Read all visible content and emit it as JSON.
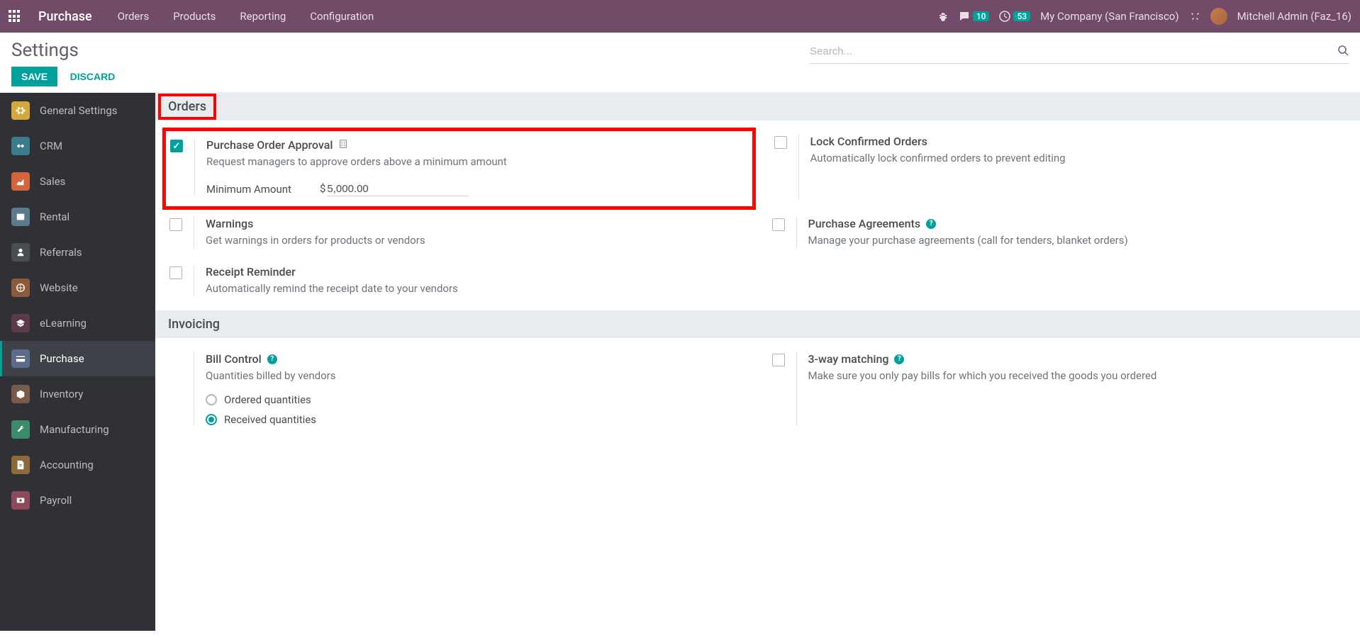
{
  "navbar": {
    "app_title": "Purchase",
    "menus": [
      "Orders",
      "Products",
      "Reporting",
      "Configuration"
    ],
    "messages_count": "10",
    "activities_count": "53",
    "company": "My Company (San Francisco)",
    "user": "Mitchell Admin (Faz_16)"
  },
  "control": {
    "title": "Settings",
    "save": "SAVE",
    "discard": "DISCARD",
    "search_placeholder": "Search..."
  },
  "sidebar": {
    "items": [
      {
        "label": "General Settings"
      },
      {
        "label": "CRM"
      },
      {
        "label": "Sales"
      },
      {
        "label": "Rental"
      },
      {
        "label": "Referrals"
      },
      {
        "label": "Website"
      },
      {
        "label": "eLearning"
      },
      {
        "label": "Purchase"
      },
      {
        "label": "Inventory"
      },
      {
        "label": "Manufacturing"
      },
      {
        "label": "Accounting"
      },
      {
        "label": "Payroll"
      }
    ],
    "active_index": 7
  },
  "sections": {
    "orders": {
      "heading": "Orders",
      "po_approval": {
        "title": "Purchase Order Approval",
        "desc": "Request managers to approve orders above a minimum amount",
        "min_label": "Minimum Amount",
        "currency": "$",
        "min_value": "5,000.00",
        "checked": true
      },
      "lock_confirmed": {
        "title": "Lock Confirmed Orders",
        "desc": "Automatically lock confirmed orders to prevent editing",
        "checked": false
      },
      "warnings": {
        "title": "Warnings",
        "desc": "Get warnings in orders for products or vendors",
        "checked": false
      },
      "purchase_agreements": {
        "title": "Purchase Agreements",
        "desc": "Manage your purchase agreements (call for tenders, blanket orders)",
        "checked": false
      },
      "receipt_reminder": {
        "title": "Receipt Reminder",
        "desc": "Automatically remind the receipt date to your vendors",
        "checked": false
      }
    },
    "invoicing": {
      "heading": "Invoicing",
      "bill_control": {
        "title": "Bill Control",
        "desc": "Quantities billed by vendors",
        "options": [
          "Ordered quantities",
          "Received quantities"
        ],
        "selected": 1
      },
      "three_way": {
        "title": "3-way matching",
        "desc": "Make sure you only pay bills for which you received the goods you ordered",
        "checked": false
      }
    }
  }
}
